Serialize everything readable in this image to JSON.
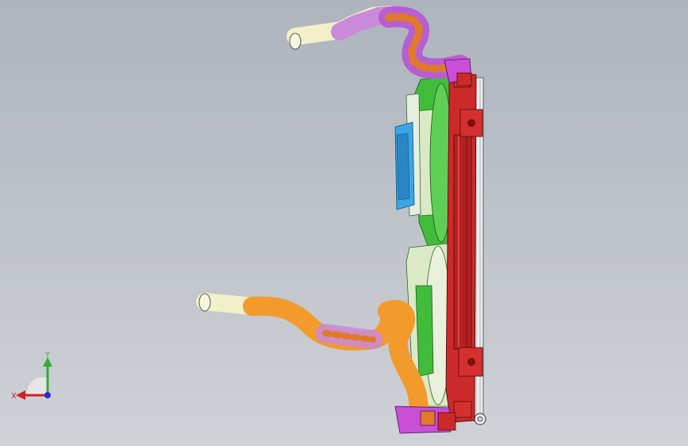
{
  "viewport": {
    "background_top": "#aeb4bd",
    "background_bottom": "#cfd2d7"
  },
  "model": {
    "parts": [
      {
        "name": "upper-hose",
        "color": "#c98ad9"
      },
      {
        "name": "upper-hose-end",
        "color": "#f1f0c9"
      },
      {
        "name": "lower-hose",
        "color": "#f39a2c"
      },
      {
        "name": "lower-hose-end",
        "color": "#f1f0c9"
      },
      {
        "name": "fan-shroud",
        "color": "#3fbd3a"
      },
      {
        "name": "fan-shroud-light",
        "color": "#dbe9c6"
      },
      {
        "name": "fan-motor",
        "color": "#3aa7e4"
      },
      {
        "name": "radiator-tank",
        "color": "#cc2a2a"
      },
      {
        "name": "radiator-core-frame",
        "color": "#ebecee"
      }
    ]
  },
  "triad": {
    "x_label": "X",
    "y_label": "Y",
    "x_color": "#d42121",
    "y_color": "#2fae2f",
    "z_color": "#2b2bd6"
  }
}
